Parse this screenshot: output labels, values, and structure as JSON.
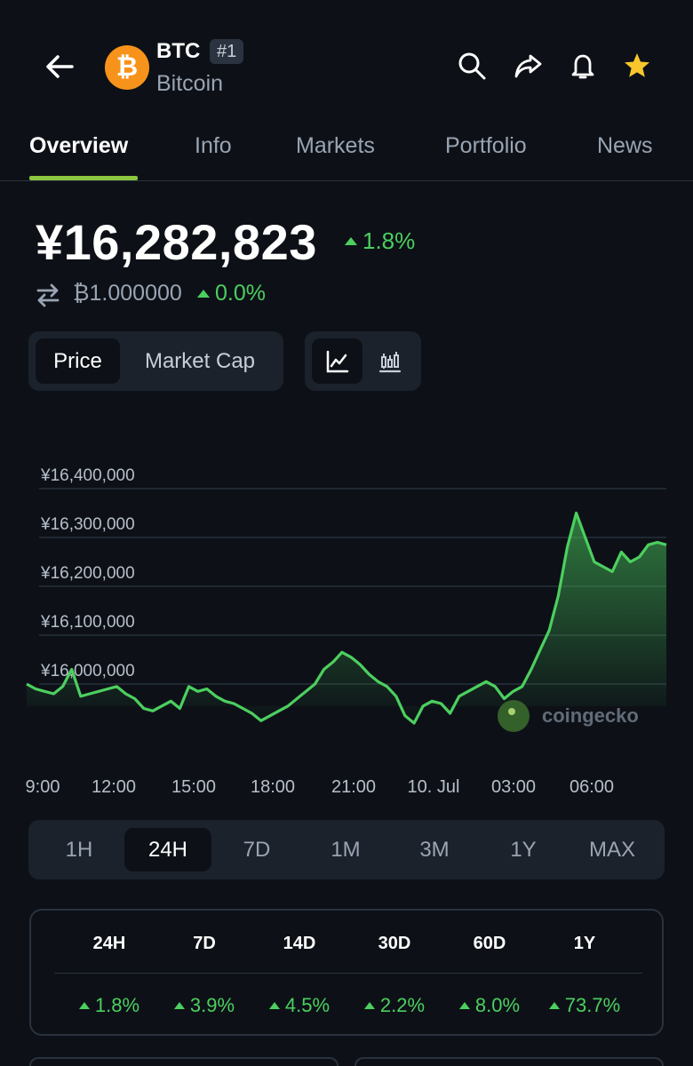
{
  "header": {
    "coin_logo_glyph": "₿",
    "symbol": "BTC",
    "rank": "#1",
    "name": "Bitcoin",
    "logo_color": "#f7931a"
  },
  "tabs": [
    {
      "label": "Overview",
      "active": true
    },
    {
      "label": "Info",
      "active": false
    },
    {
      "label": "Markets",
      "active": false
    },
    {
      "label": "Portfolio",
      "active": false
    },
    {
      "label": "News",
      "active": false
    }
  ],
  "price": {
    "value": "¥16,282,823",
    "change": "1.8%",
    "btc_value": "₿1.000000",
    "btc_change": "0.0%"
  },
  "toggle": {
    "price_label": "Price",
    "market_cap_label": "Market Cap",
    "selected": "Price",
    "chart_types": [
      "line-chart-icon",
      "candlestick-chart-icon"
    ],
    "selected_chart_type": "line-chart-icon"
  },
  "chart_data": {
    "type": "area",
    "y_ticks": [
      "¥16,400,000",
      "¥16,300,000",
      "¥16,200,000",
      "¥16,100,000",
      "¥16,000,000"
    ],
    "x_ticks": [
      "9:00",
      "12:00",
      "15:00",
      "18:00",
      "21:00",
      "10. Jul",
      "03:00",
      "06:00"
    ],
    "ylim": [
      15900000,
      16400000
    ],
    "watermark": "coingecko",
    "line_color": "#4ccf5f",
    "series": [
      {
        "values": [
          16000000,
          15990000,
          15985000,
          15980000,
          15995000,
          16030000,
          15975000,
          15980000,
          15985000,
          15990000,
          15995000,
          15980000,
          15970000,
          15950000,
          15945000,
          15955000,
          15965000,
          15950000,
          15995000,
          15985000,
          15990000,
          15975000,
          15965000,
          15960000,
          15950000,
          15940000,
          15925000,
          15935000,
          15945000,
          15955000,
          15970000,
          15985000,
          16000000,
          16030000,
          16045000,
          16065000,
          16055000,
          16040000,
          16020000,
          16005000,
          15995000,
          15975000,
          15935000,
          15920000,
          15955000,
          15965000,
          15960000,
          15940000,
          15975000,
          15985000,
          15995000,
          16005000,
          15995000,
          15970000,
          15985000,
          15995000,
          16030000,
          16070000,
          16110000,
          16180000,
          16280000,
          16350000,
          16300000,
          16250000,
          16240000,
          16230000,
          16270000,
          16250000,
          16260000,
          16285000,
          16290000,
          16285000
        ]
      }
    ]
  },
  "ranges": {
    "items": [
      "1H",
      "24H",
      "7D",
      "1M",
      "3M",
      "1Y",
      "MAX"
    ],
    "selected": "24H"
  },
  "performance": {
    "headers": [
      "24H",
      "7D",
      "14D",
      "30D",
      "60D",
      "1Y"
    ],
    "values": [
      "1.8%",
      "3.9%",
      "4.5%",
      "2.2%",
      "8.0%",
      "73.7%"
    ]
  }
}
